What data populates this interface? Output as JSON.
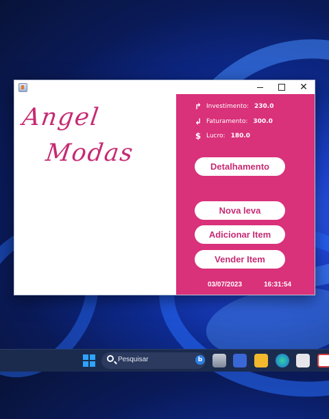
{
  "app": {
    "logo_line1": "Angel",
    "logo_line2": "Modas"
  },
  "window_controls": {
    "minimize": "—",
    "maximize": "☐",
    "close": "✕"
  },
  "stats": [
    {
      "icon": "↱",
      "label": "Investimento:",
      "value": "230.0"
    },
    {
      "icon": "↲",
      "label": "Faturamento:",
      "value": "300.0"
    },
    {
      "icon": "$",
      "label": "Lucro:",
      "value": "180.0"
    }
  ],
  "buttons": {
    "detalhamento": "Detalhamento",
    "nova_leva": "Nova leva",
    "adicionar_item": "Adicionar Item",
    "vender_item": "Vender Item"
  },
  "footer": {
    "date": "03/07/2023",
    "time": "16:31:54"
  },
  "taskbar": {
    "search_placeholder": "Pesquisar"
  },
  "colors": {
    "accent": "#d9317a",
    "logo": "#c62a73"
  }
}
